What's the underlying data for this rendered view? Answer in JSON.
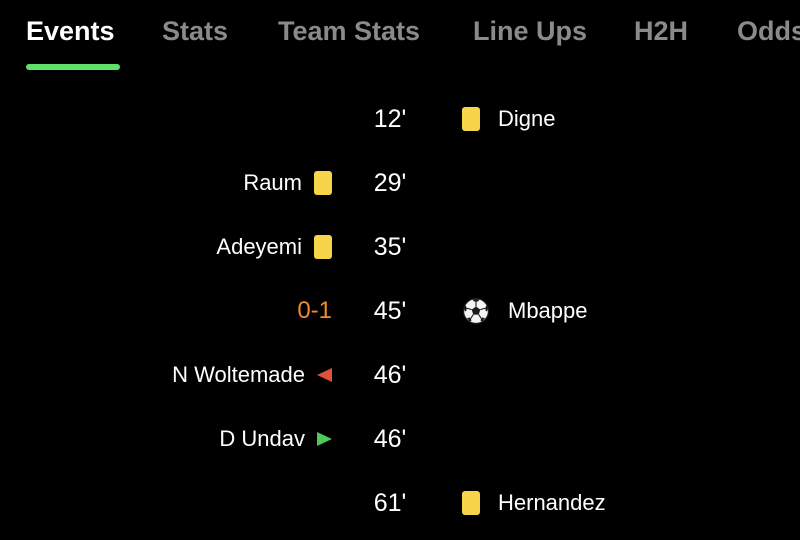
{
  "colors": {
    "background": "#000000",
    "accent": "#5fe06a",
    "tab_inactive": "#8a8a8a",
    "yellow_card": "#f7d54a",
    "score": "#f08a2e",
    "sub_out": "#e0503a",
    "sub_in": "#4ec95a"
  },
  "tabs": [
    {
      "label": "Events",
      "active": true
    },
    {
      "label": "Stats",
      "active": false
    },
    {
      "label": "Team Stats",
      "active": false
    },
    {
      "label": "Line Ups",
      "active": false
    },
    {
      "label": "H2H",
      "active": false
    },
    {
      "label": "Odds",
      "active": false
    }
  ],
  "events": [
    {
      "minute": "12'",
      "away": {
        "player": "Digne",
        "icon": "yellow-card-icon"
      }
    },
    {
      "minute": "29'",
      "home": {
        "player": "Raum",
        "icon": "yellow-card-icon"
      }
    },
    {
      "minute": "35'",
      "home": {
        "player": "Adeyemi",
        "icon": "yellow-card-icon"
      }
    },
    {
      "minute": "45'",
      "home": {
        "score": "0-1"
      },
      "away": {
        "player": "Mbappe",
        "icon": "soccer-ball-icon"
      }
    },
    {
      "minute": "46'",
      "home": {
        "player": "N Woltemade",
        "icon": "substitution-out-icon"
      }
    },
    {
      "minute": "46'",
      "home": {
        "player": "D Undav",
        "icon": "substitution-in-icon"
      }
    },
    {
      "minute": "61'",
      "away": {
        "player": "Hernandez",
        "icon": "yellow-card-icon"
      }
    }
  ]
}
